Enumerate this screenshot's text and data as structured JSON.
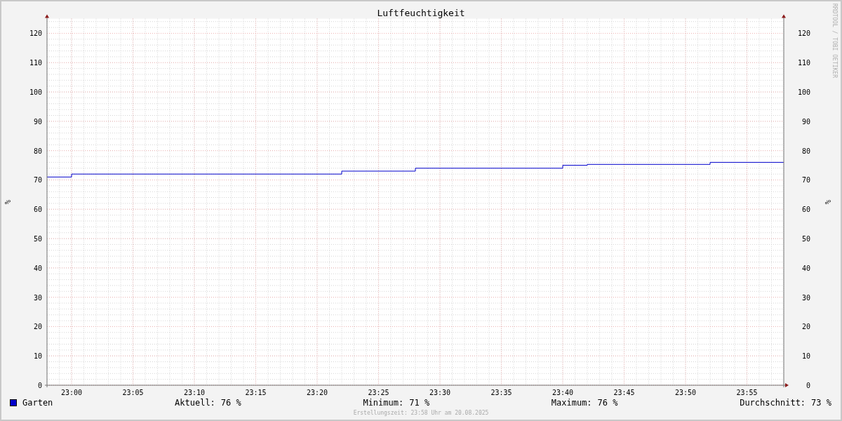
{
  "chart": {
    "chart_data": {
      "type": "line",
      "title": "Luftfeuchtigkeit",
      "ylabel": "%",
      "grid": true,
      "x": [
        1378,
        1380,
        1380,
        1402,
        1402,
        1408,
        1408,
        1420,
        1420,
        1422,
        1422,
        1432,
        1432,
        1438
      ],
      "series": [
        {
          "name": "Garten",
          "color": "#0000cc",
          "values": [
            71,
            71,
            72,
            72,
            73,
            73,
            74,
            74,
            75,
            75,
            75.3,
            75.3,
            76,
            76
          ]
        }
      ],
      "xlim": [
        1378,
        1438
      ],
      "ylim": [
        0,
        125
      ],
      "xticks": [
        {
          "value": 1380,
          "label": "23:00"
        },
        {
          "value": 1385,
          "label": "23:05"
        },
        {
          "value": 1390,
          "label": "23:10"
        },
        {
          "value": 1395,
          "label": "23:15"
        },
        {
          "value": 1400,
          "label": "23:20"
        },
        {
          "value": 1405,
          "label": "23:25"
        },
        {
          "value": 1410,
          "label": "23:30"
        },
        {
          "value": 1415,
          "label": "23:35"
        },
        {
          "value": 1420,
          "label": "23:40"
        },
        {
          "value": 1425,
          "label": "23:45"
        },
        {
          "value": 1430,
          "label": "23:50"
        },
        {
          "value": 1435,
          "label": "23:55"
        }
      ],
      "yticks": [
        {
          "value": 0,
          "label": "0"
        },
        {
          "value": 10,
          "label": "10"
        },
        {
          "value": 20,
          "label": "20"
        },
        {
          "value": 30,
          "label": "30"
        },
        {
          "value": 40,
          "label": "40"
        },
        {
          "value": 50,
          "label": "50"
        },
        {
          "value": 60,
          "label": "60"
        },
        {
          "value": 70,
          "label": "70"
        },
        {
          "value": 80,
          "label": "80"
        },
        {
          "value": 90,
          "label": "90"
        },
        {
          "value": 100,
          "label": "100"
        },
        {
          "value": 110,
          "label": "110"
        },
        {
          "value": 120,
          "label": "120"
        }
      ]
    },
    "right_axis": {
      "label": "%",
      "ticks": [
        "120",
        "110",
        "100",
        "90",
        "80",
        "70",
        "60",
        "50",
        "40",
        "30",
        "20",
        "10",
        "0"
      ]
    },
    "side_note": "RRDTOOL / TOBI OETIKER",
    "legend_stats": [
      {
        "label": "Aktuell:",
        "value": "76 %"
      },
      {
        "label": "Minimum:",
        "value": "71 %"
      },
      {
        "label": "Maximum:",
        "value": "76 %"
      },
      {
        "label": "Durchschnitt:",
        "value": "73 %"
      }
    ],
    "footer": "Erstellungszeit: 23:58 Uhr am 20.08.2025"
  }
}
